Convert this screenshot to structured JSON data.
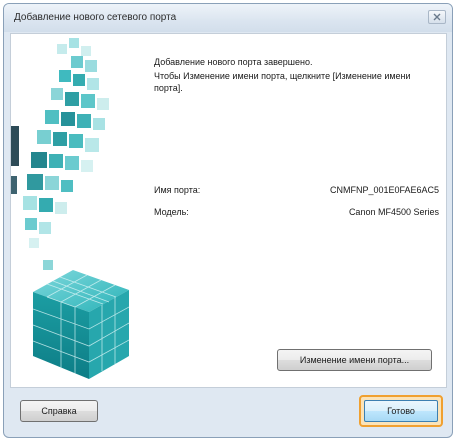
{
  "window": {
    "title": "Добавление нового сетевого порта"
  },
  "message": {
    "line1": "Добавление нового порта завершено.",
    "line2": "Чтобы Изменение имени порта, щелкните [Изменение имени порта]."
  },
  "details": {
    "port_name_label": "Имя порта:",
    "port_name_value": "CNMFNP_001E0FAE6AC5",
    "model_label": "Модель:",
    "model_value": "Canon MF4500 Series"
  },
  "buttons": {
    "rename_label": "Изменение имени порта...",
    "help_label": "Справка",
    "finish_label": "Готово"
  },
  "colors": {
    "art_teal": "#1fa3a8",
    "art_light": "#bfe9ea",
    "finish_highlight": "#f0a030"
  }
}
